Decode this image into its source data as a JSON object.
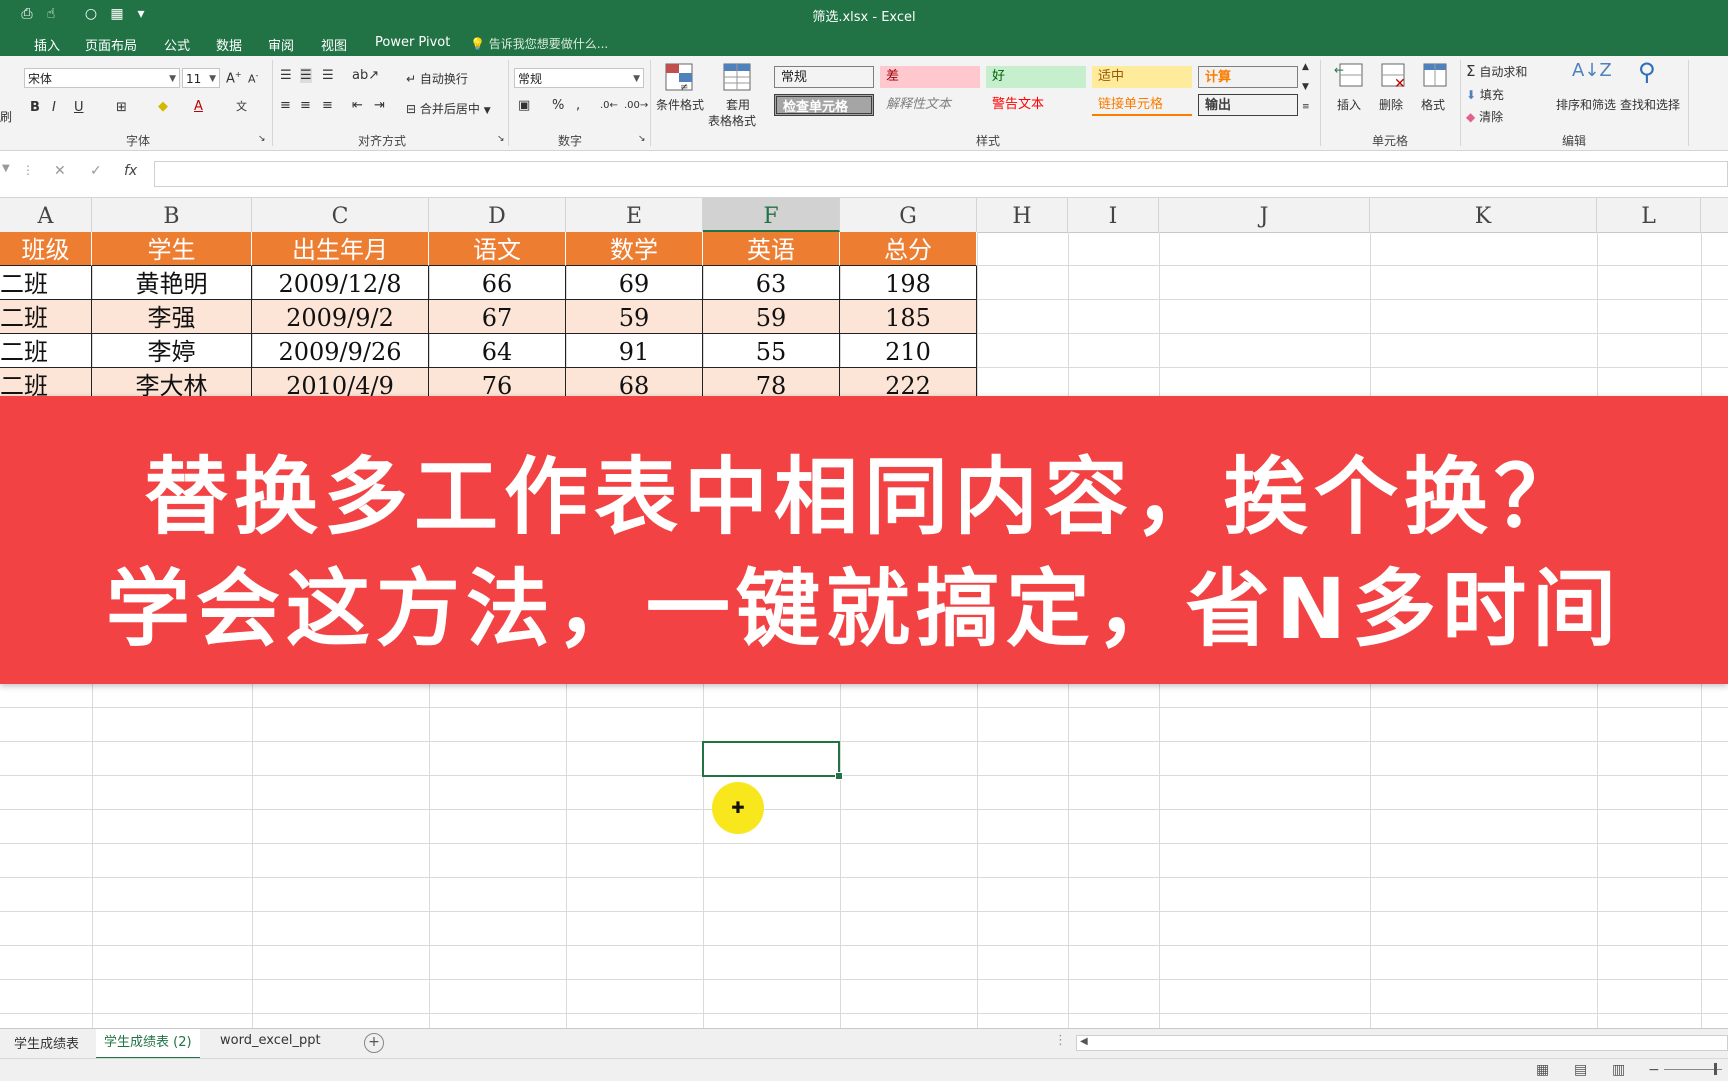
{
  "window": {
    "title": "筛选.xlsx - Excel"
  },
  "ribbon_tabs": [
    "插入",
    "页面布局",
    "公式",
    "数据",
    "审阅",
    "视图",
    "Power Pivot"
  ],
  "tell_me": "告诉我您想要做什么...",
  "font": {
    "name": "宋体",
    "size": "11"
  },
  "number_format": "常规",
  "ribbon_buttons": {
    "wrap_text": "自动换行",
    "merge_center": "合并后居中",
    "conditional_format": "条件格式",
    "table_format_line1": "套用",
    "table_format_line2": "表格格式",
    "insert": "插入",
    "delete": "删除",
    "format": "格式",
    "autosum": "自动求和",
    "fill": "填充",
    "clear": "清除",
    "sort_filter": "排序和筛选",
    "find_select": "查找和选择",
    "paste_hint": "刷"
  },
  "cell_styles": [
    {
      "label": "常规",
      "bg": "#ffffff",
      "fg": "#000000"
    },
    {
      "label": "差",
      "bg": "#ffc7ce",
      "fg": "#9c0006"
    },
    {
      "label": "好",
      "bg": "#c6efce",
      "fg": "#006100"
    },
    {
      "label": "适中",
      "bg": "#ffeb9c",
      "fg": "#9c5700"
    },
    {
      "label": "计算",
      "bg": "#f2f2f2",
      "fg": "#fa7d00"
    },
    {
      "label": "检查单元格",
      "bg": "#a5a5a5",
      "fg": "#ffffff"
    },
    {
      "label": "解释性文本",
      "bg": "#f3f3f3",
      "fg": "#7f7f7f"
    },
    {
      "label": "警告文本",
      "bg": "#f3f3f3",
      "fg": "#ff0000"
    },
    {
      "label": "链接单元格",
      "bg": "#f3f3f3",
      "fg": "#fa7d00"
    },
    {
      "label": "输出",
      "bg": "#f2f2f2",
      "fg": "#3f3f3f"
    }
  ],
  "group_labels": {
    "font": "字体",
    "alignment": "对齐方式",
    "number": "数字",
    "styles": "样式",
    "cells": "单元格",
    "editing": "编辑"
  },
  "formula_bar": {
    "cancel": "✕",
    "enter": "✓",
    "fx": "fx",
    "value": ""
  },
  "columns": [
    "A",
    "B",
    "C",
    "D",
    "E",
    "F",
    "G",
    "H",
    "I",
    "J",
    "K",
    "L"
  ],
  "selected_column": "F",
  "table": {
    "headers": [
      "班级",
      "学生",
      "出生年月",
      "语文",
      "数学",
      "英语",
      "总分"
    ],
    "rows": [
      [
        "二班",
        "黄艳明",
        "2009/12/8",
        "66",
        "69",
        "63",
        "198"
      ],
      [
        "二班",
        "李强",
        "2009/9/2",
        "67",
        "59",
        "59",
        "185"
      ],
      [
        "二班",
        "李婷",
        "2009/9/26",
        "64",
        "91",
        "55",
        "210"
      ],
      [
        "二班",
        "李大林",
        "2010/4/9",
        "76",
        "68",
        "78",
        "222"
      ]
    ]
  },
  "banner": {
    "line1": "替换多工作表中相同内容，挨个换？",
    "line2": "学会这方法，一键就搞定，省N多时间"
  },
  "sheets": [
    "学生成绩表",
    "学生成绩表 (2)",
    "word_excel_ppt"
  ],
  "active_sheet": "学生成绩表 (2)"
}
